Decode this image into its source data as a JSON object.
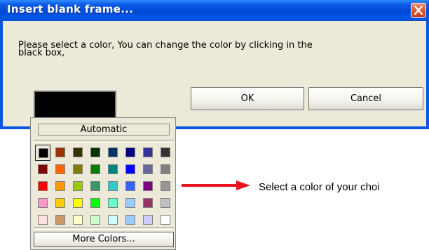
{
  "dialog": {
    "title": "Insert blank frame...",
    "message_line1": "Please select a color,  You can change the color by clicking in the",
    "message_line2": "black box,",
    "ok_label": "OK",
    "cancel_label": "Cancel",
    "selected_color": "#000000",
    "close_icon": "close-icon"
  },
  "color_picker": {
    "automatic_label": "Automatic",
    "more_colors_label": "More Colors...",
    "selected_index": 0,
    "rows": [
      [
        "#000000",
        "#993300",
        "#333300",
        "#003300",
        "#003366",
        "#000080",
        "#333399",
        "#333333"
      ],
      [
        "#800000",
        "#FF6600",
        "#808000",
        "#008000",
        "#008080",
        "#0000FF",
        "#666699",
        "#808080"
      ],
      [
        "#FF0000",
        "#FF9900",
        "#99CC00",
        "#339966",
        "#33CCCC",
        "#3366FF",
        "#800080",
        "#969696"
      ],
      [
        "#FF99CC",
        "#FFCC00",
        "#FFFF00",
        "#00FF00",
        "#66FFCC",
        "#99CCFF",
        "#993366",
        "#C0C0C0"
      ],
      [
        "#FFE0E0",
        "#CC9966",
        "#FFFFCC",
        "#CCFFCC",
        "#CCFFFF",
        "#99CCFF",
        "#CCCCFF",
        "#FFFFFF"
      ]
    ]
  },
  "annotation": {
    "text": "Select a color of your choi",
    "arrow_color": "#e8141b",
    "arrow_icon": "arrow-right-icon"
  },
  "colors": {
    "titlebar": "#0a55e2",
    "dialog_bg": "#ece9d8"
  }
}
